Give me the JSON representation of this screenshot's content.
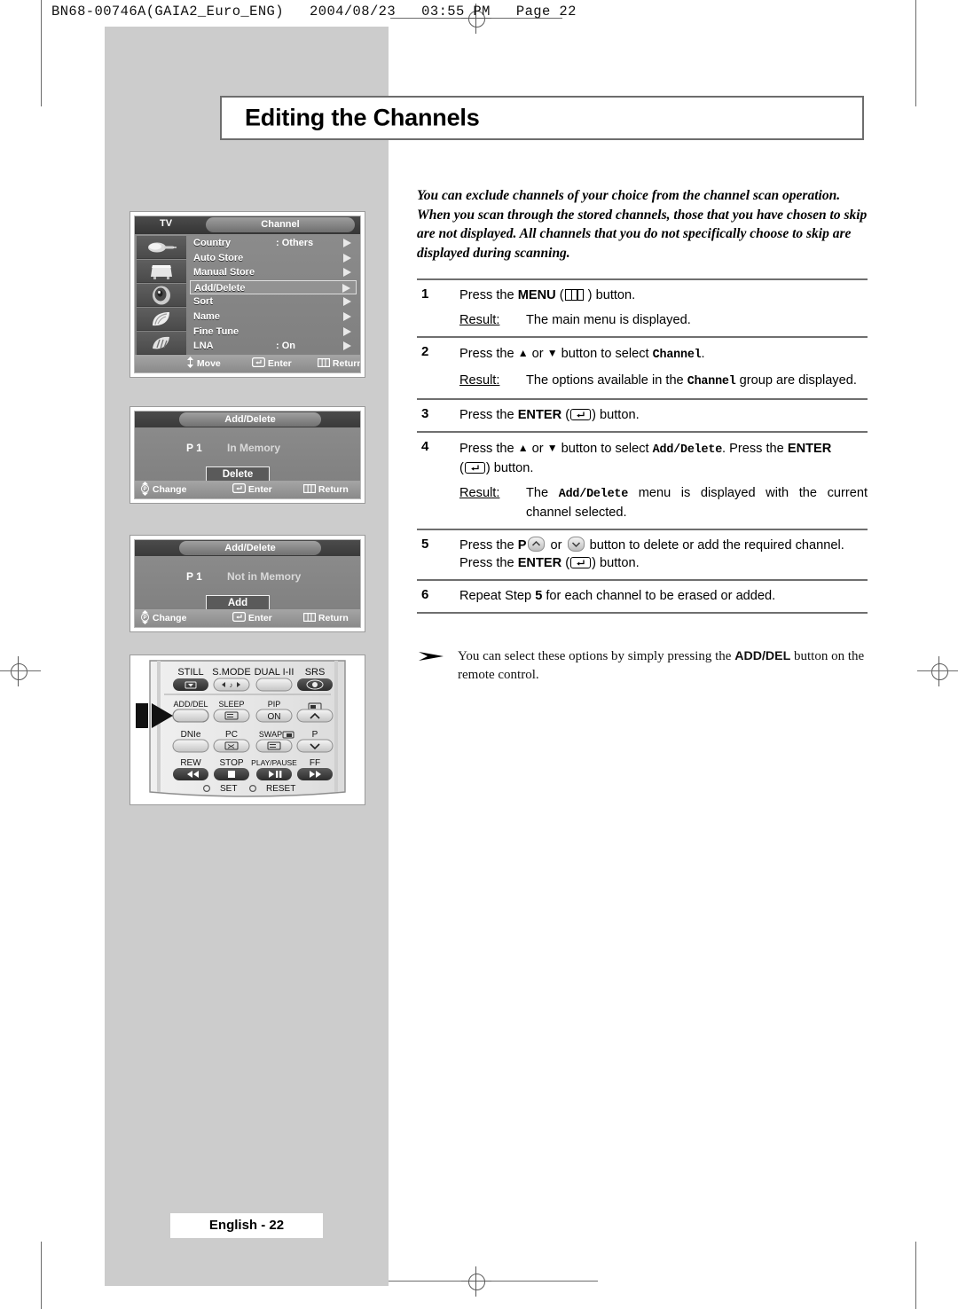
{
  "print_header": "BN68-00746A(GAIA2_Euro_ENG)   2004/08/23   03:55 PM   Page 22",
  "page_title": "Editing the Channels",
  "intro": "You can exclude channels of your choice from the channel scan operation. When you scan through the stored channels, those that you have chosen to skip are not displayed. All channels that you do not specifically choose to skip are displayed during scanning.",
  "osd_menu": {
    "source_label": "TV",
    "title": "Channel",
    "icons": [
      "antenna-icon",
      "tv-icon",
      "speaker-icon",
      "feather-icon",
      "hand-icon"
    ],
    "rows": [
      {
        "label": "Country",
        "value": ": Others"
      },
      {
        "label": "Auto Store",
        "value": ""
      },
      {
        "label": "Manual Store",
        "value": ""
      },
      {
        "label": "Add/Delete",
        "value": "",
        "selected": true
      },
      {
        "label": "Sort",
        "value": ""
      },
      {
        "label": "Name",
        "value": ""
      },
      {
        "label": "Fine Tune",
        "value": ""
      },
      {
        "label": "LNA",
        "value": ": On"
      }
    ],
    "hints": [
      {
        "icon": "up-down-arrow-icon",
        "label": "Move"
      },
      {
        "icon": "enter-icon",
        "label": "Enter"
      },
      {
        "icon": "menu-icon",
        "label": "Return"
      }
    ]
  },
  "osd_delete": {
    "title": "Add/Delete",
    "channel": "P  1",
    "status": "In Memory",
    "button": "Delete",
    "hints": [
      {
        "icon": "p-updown-icon",
        "label": "Change"
      },
      {
        "icon": "enter-icon",
        "label": "Enter"
      },
      {
        "icon": "menu-icon",
        "label": "Return"
      }
    ]
  },
  "osd_add": {
    "title": "Add/Delete",
    "channel": "P  1",
    "status": "Not in Memory",
    "button": "Add",
    "hints": [
      {
        "icon": "p-updown-icon",
        "label": "Change"
      },
      {
        "icon": "enter-icon",
        "label": "Enter"
      },
      {
        "icon": "menu-icon",
        "label": "Return"
      }
    ]
  },
  "remote": {
    "rows": [
      [
        {
          "label": "STILL",
          "key": "still-button"
        },
        {
          "label": "S.MODE",
          "key": "sound-mode-button"
        },
        {
          "label": "DUAL I-II",
          "key": "dual-button"
        },
        {
          "label": "SRS",
          "key": "srs-button"
        }
      ],
      [
        {
          "label": "ADD/DEL",
          "key": "add-del-button",
          "highlight": true
        },
        {
          "label": "SLEEP",
          "key": "sleep-button"
        },
        {
          "label": "PIP",
          "key": "pip-on-button",
          "face": "ON"
        },
        {
          "label": "",
          "key": "channel-up-button"
        }
      ],
      [
        {
          "label": "DNIe",
          "key": "dnie-button"
        },
        {
          "label": "PC",
          "key": "pc-button"
        },
        {
          "label": "SWAP",
          "key": "swap-button"
        },
        {
          "label": "P",
          "key": "channel-down-button"
        }
      ],
      [
        {
          "label": "REW",
          "key": "rewind-button"
        },
        {
          "label": "STOP",
          "key": "stop-button"
        },
        {
          "label": "PLAY/PAUSE",
          "key": "play-pause-button"
        },
        {
          "label": "FF",
          "key": "fast-forward-button"
        }
      ]
    ],
    "bottom": [
      {
        "label": "SET",
        "key": "set-button"
      },
      {
        "label": "RESET",
        "key": "reset-button"
      }
    ]
  },
  "steps": [
    {
      "num": "1",
      "text_a": "Press the ",
      "bold": "MENU",
      "icon": "menu-icon",
      "text_b": " button.",
      "result_word": "Result:",
      "result_text": "The main menu is displayed."
    },
    {
      "num": "2",
      "text_a": "Press the ",
      "text_b": " button to select ",
      "mono": "Channel",
      "text_c": ".",
      "result_word": "Result:",
      "result_a": "The options available in the ",
      "result_mono": "Channel",
      "result_b": " group are displayed."
    },
    {
      "num": "3",
      "text_a": "Press the ",
      "bold": "ENTER",
      "icon": "enter-icon",
      "text_b": " button."
    },
    {
      "num": "4",
      "text_a": "Press the ",
      "text_b": " button to select ",
      "mono": "Add/Delete",
      "text_c": ". Press the ",
      "bold": "ENTER",
      "icon": "enter-icon",
      "text_d": " button.",
      "result_word": "Result:",
      "result_a": "The ",
      "result_mono": "Add/Delete",
      "result_b": " menu is displayed with the current channel selected."
    },
    {
      "num": "5",
      "text_a": "Press the ",
      "bold": "P",
      "text_b": " or ",
      "text_c": " button to delete or add the required channel. Press the ",
      "bold2": "ENTER",
      "icon": "enter-icon",
      "text_d": " button."
    },
    {
      "num": "6",
      "text_a": "Repeat Step ",
      "bold": "5",
      "text_b": " for each channel to be erased or added."
    }
  ],
  "note": {
    "icon": "arrow-bullet-icon",
    "text_a": "You can select these options by simply pressing the ",
    "bold": "ADD/DEL",
    "text_b": " button on the remote control."
  },
  "footer": "English - 22",
  "colors": {
    "page_gray": "#cccccc",
    "rule": "#6f6f6f",
    "osd_dark": "#4b4b4b",
    "osd_body": "#8d8d8d"
  }
}
